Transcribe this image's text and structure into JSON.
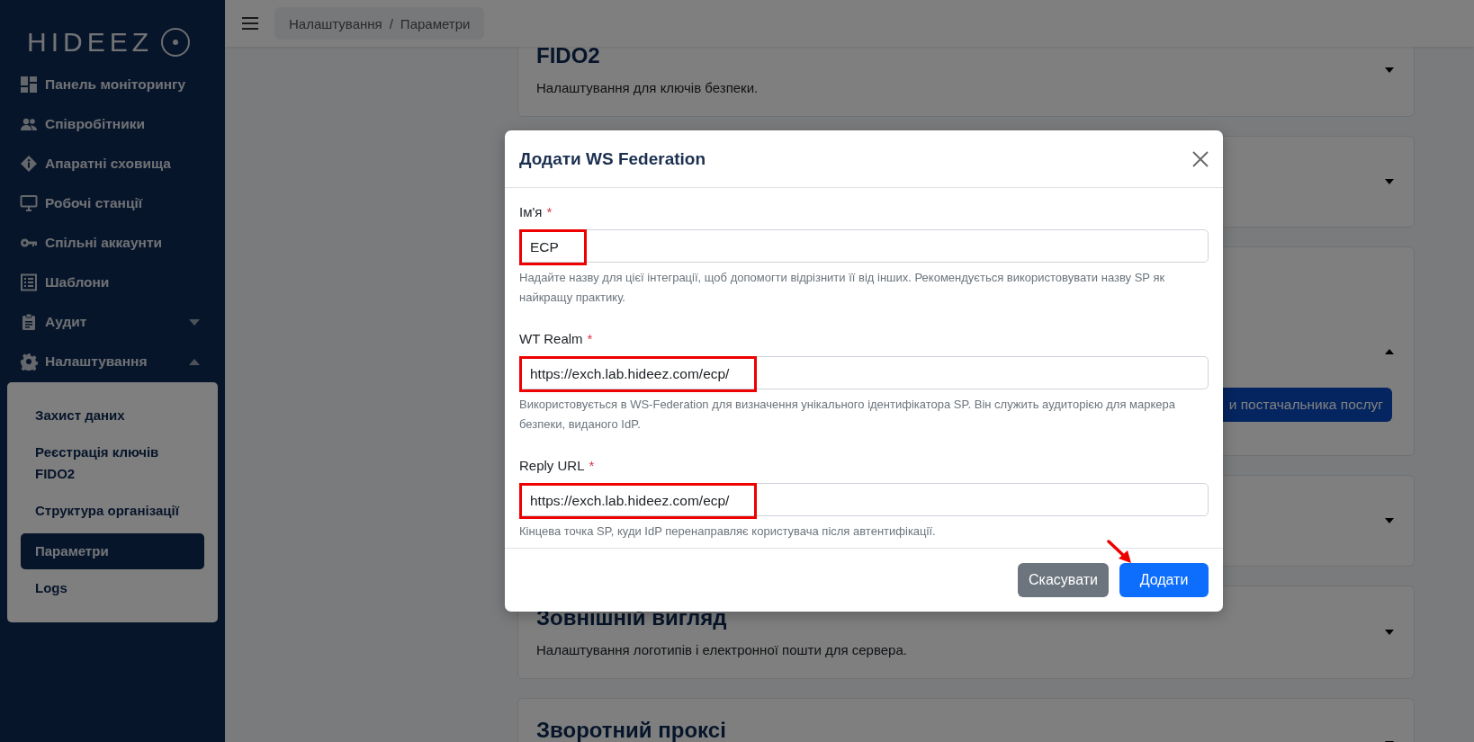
{
  "sidebar": {
    "logo": "HIDEEZ",
    "items": [
      {
        "label": "Панель моніторингу",
        "kind": "dashboard",
        "selected": false
      },
      {
        "label": "Співробітники",
        "kind": "people",
        "selected": false
      },
      {
        "label": "Апаратні сховища",
        "kind": "info",
        "selected": false
      },
      {
        "label": "Робочі станції",
        "kind": "monitor",
        "selected": false
      },
      {
        "label": "Спільні аккаунти",
        "kind": "key",
        "selected": false
      },
      {
        "label": "Шаблони",
        "kind": "list",
        "selected": false
      },
      {
        "label": "Аудит",
        "kind": "clipboard",
        "selected": false,
        "expanded": false
      },
      {
        "label": "Налаштування",
        "kind": "gear",
        "selected": false,
        "expanded": true,
        "children": [
          {
            "label": "Захист даних",
            "selected": false
          },
          {
            "label": "Реєстрація ключів FIDO2",
            "selected": false
          },
          {
            "label": "Структура організації",
            "selected": false
          },
          {
            "label": "Параметри",
            "selected": true
          },
          {
            "label": "Logs",
            "selected": false
          }
        ]
      }
    ]
  },
  "header": {
    "breadcrumb": [
      "Налаштування",
      "Параметри"
    ],
    "separator": "/"
  },
  "sections": [
    {
      "title": "FIDO2",
      "description": "Налаштування для ключів безпеки.",
      "expanded": false
    },
    {
      "expanded": false
    },
    {
      "expanded": true,
      "button": "и постачальника послуг"
    },
    {
      "expanded": false
    },
    {
      "title": "Зовнішній вигляд",
      "description": "Налаштування логотипів і електронної пошти для сервера.",
      "expanded": false
    },
    {
      "title": "Зворотний проксі",
      "expanded": false
    }
  ],
  "modal": {
    "title": "Додати WS Federation",
    "fields": [
      {
        "label": "Ім'я",
        "required_mark": "*",
        "value": "ECP",
        "highlighted": true,
        "hint": "Надайте назву для цієї інтеграції, щоб допомогти відрізнити її від інших. Рекомендується використовувати назву SP як найкращу практику."
      },
      {
        "label": "WT Realm",
        "required_mark": "*",
        "value": "https://exch.lab.hideez.com/ecp/",
        "highlighted": true,
        "hint": "Використовується в WS-Federation для визначення унікального ідентифікатора SP. Він служить аудиторією для маркера безпеки, виданого IdP."
      },
      {
        "label": "Reply URL",
        "required_mark": "*",
        "value": "https://exch.lab.hideez.com/ecp/",
        "highlighted": true,
        "hint": "Кінцева точка SP, куди IdP перенаправляє користувача після автентифікації."
      }
    ],
    "buttons": [
      {
        "label": "Скасувати",
        "kind": "secondary",
        "pointed": false
      },
      {
        "label": "Додати",
        "kind": "primary",
        "pointed": true
      }
    ]
  }
}
